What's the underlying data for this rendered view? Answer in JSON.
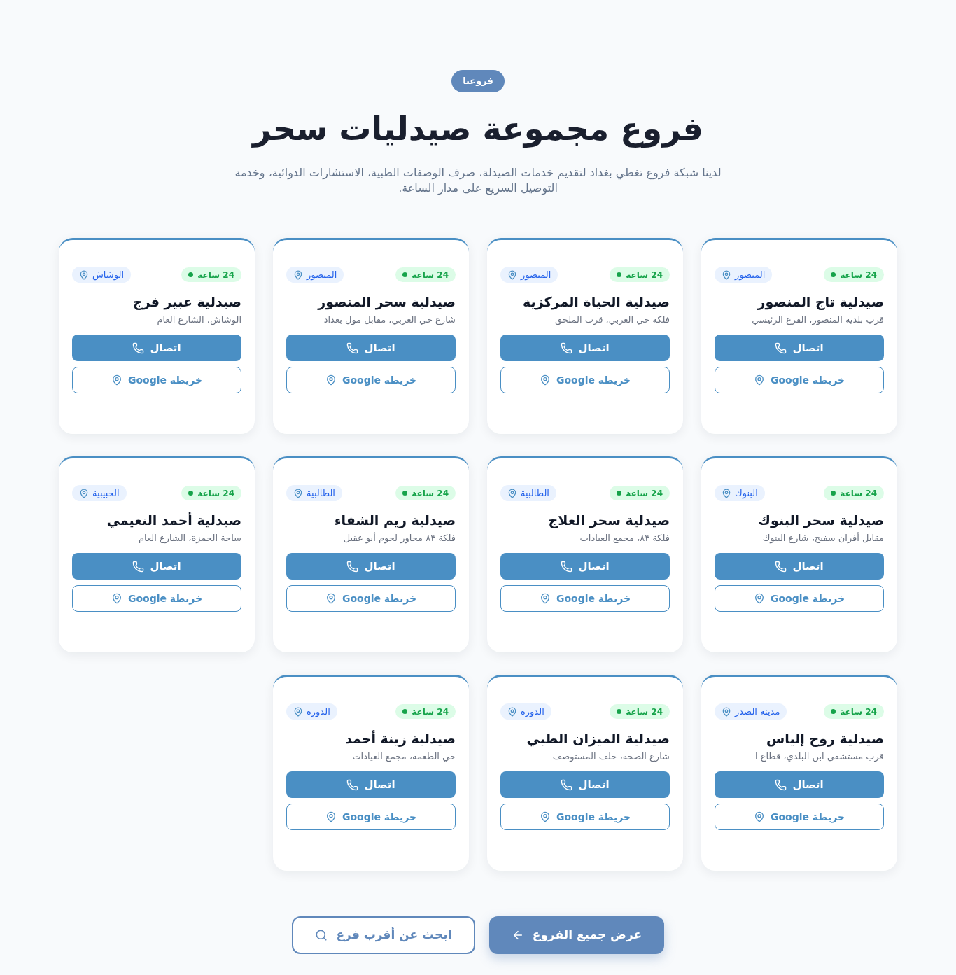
{
  "section": {
    "eyebrow": "فروعنا",
    "title": "فروع مجموعة صيدليات سحر",
    "description": "لدينا شبكة فروع تغطي بغداد لتقديم خدمات الصيدلة، صرف الوصفات الطبية، الاستشارات الدوائية، وخدمة التوصيل السريع على مدار الساعة."
  },
  "branches": [
    {
      "hours": "24 ساعة",
      "area": "المنصور",
      "name": "صيدلية تاج المنصور",
      "address": "قرب بلدية المنصور، الفرع الرئيسي",
      "call_label": "اتصال",
      "map_label": "خريطة Google"
    },
    {
      "hours": "24 ساعة",
      "area": "المنصور",
      "name": "صيدلية الحياة المركزية",
      "address": "فلكة حي العربي، قرب الملحق",
      "call_label": "اتصال",
      "map_label": "خريطة Google"
    },
    {
      "hours": "24 ساعة",
      "area": "المنصور",
      "name": "صيدلية سحر المنصور",
      "address": "شارع حي العربي، مقابل مول بغداد",
      "call_label": "اتصال",
      "map_label": "خريطة Google"
    },
    {
      "hours": "24 ساعة",
      "area": "الوشاش",
      "name": "صيدلية عبير فرج",
      "address": "الوشاش، الشارع العام",
      "call_label": "اتصال",
      "map_label": "خريطة Google"
    },
    {
      "hours": "24 ساعة",
      "area": "البنوك",
      "name": "صيدلية سحر البنوك",
      "address": "مقابل أفران سفيح، شارع البنوك",
      "call_label": "اتصال",
      "map_label": "خريطة Google"
    },
    {
      "hours": "24 ساعة",
      "area": "الطالبية",
      "name": "صيدلية سحر العلاج",
      "address": "فلكة ٨٣، مجمع العيادات",
      "call_label": "اتصال",
      "map_label": "خريطة Google"
    },
    {
      "hours": "24 ساعة",
      "area": "الطالبية",
      "name": "صيدلية ريم الشفاء",
      "address": "فلكة ٨٣ مجاور لحوم أبو عقيل",
      "call_label": "اتصال",
      "map_label": "خريطة Google"
    },
    {
      "hours": "24 ساعة",
      "area": "الحبيبية",
      "name": "صيدلية أحمد النعيمي",
      "address": "ساحة الحمزة، الشارع العام",
      "call_label": "اتصال",
      "map_label": "خريطة Google"
    },
    {
      "hours": "24 ساعة",
      "area": "مدينة الصدر",
      "name": "صيدلية روح إلياس",
      "address": "قرب مستشفى ابن البلدي، قطاع ا",
      "call_label": "اتصال",
      "map_label": "خريطة Google"
    },
    {
      "hours": "24 ساعة",
      "area": "الدورة",
      "name": "صيدلية الميزان الطبي",
      "address": "شارع الصحة، خلف المستوصف",
      "call_label": "اتصال",
      "map_label": "خريطة Google"
    },
    {
      "hours": "24 ساعة",
      "area": "الدورة",
      "name": "صيدلية زينة أحمد",
      "address": "حي الطعمة، مجمع العيادات",
      "call_label": "اتصال",
      "map_label": "خريطة Google"
    }
  ],
  "actions": [
    {
      "label": "عرض جميع الفروع",
      "kind": "primary"
    },
    {
      "label": "ابحث عن أقرب فرع",
      "kind": "secondary"
    }
  ]
}
